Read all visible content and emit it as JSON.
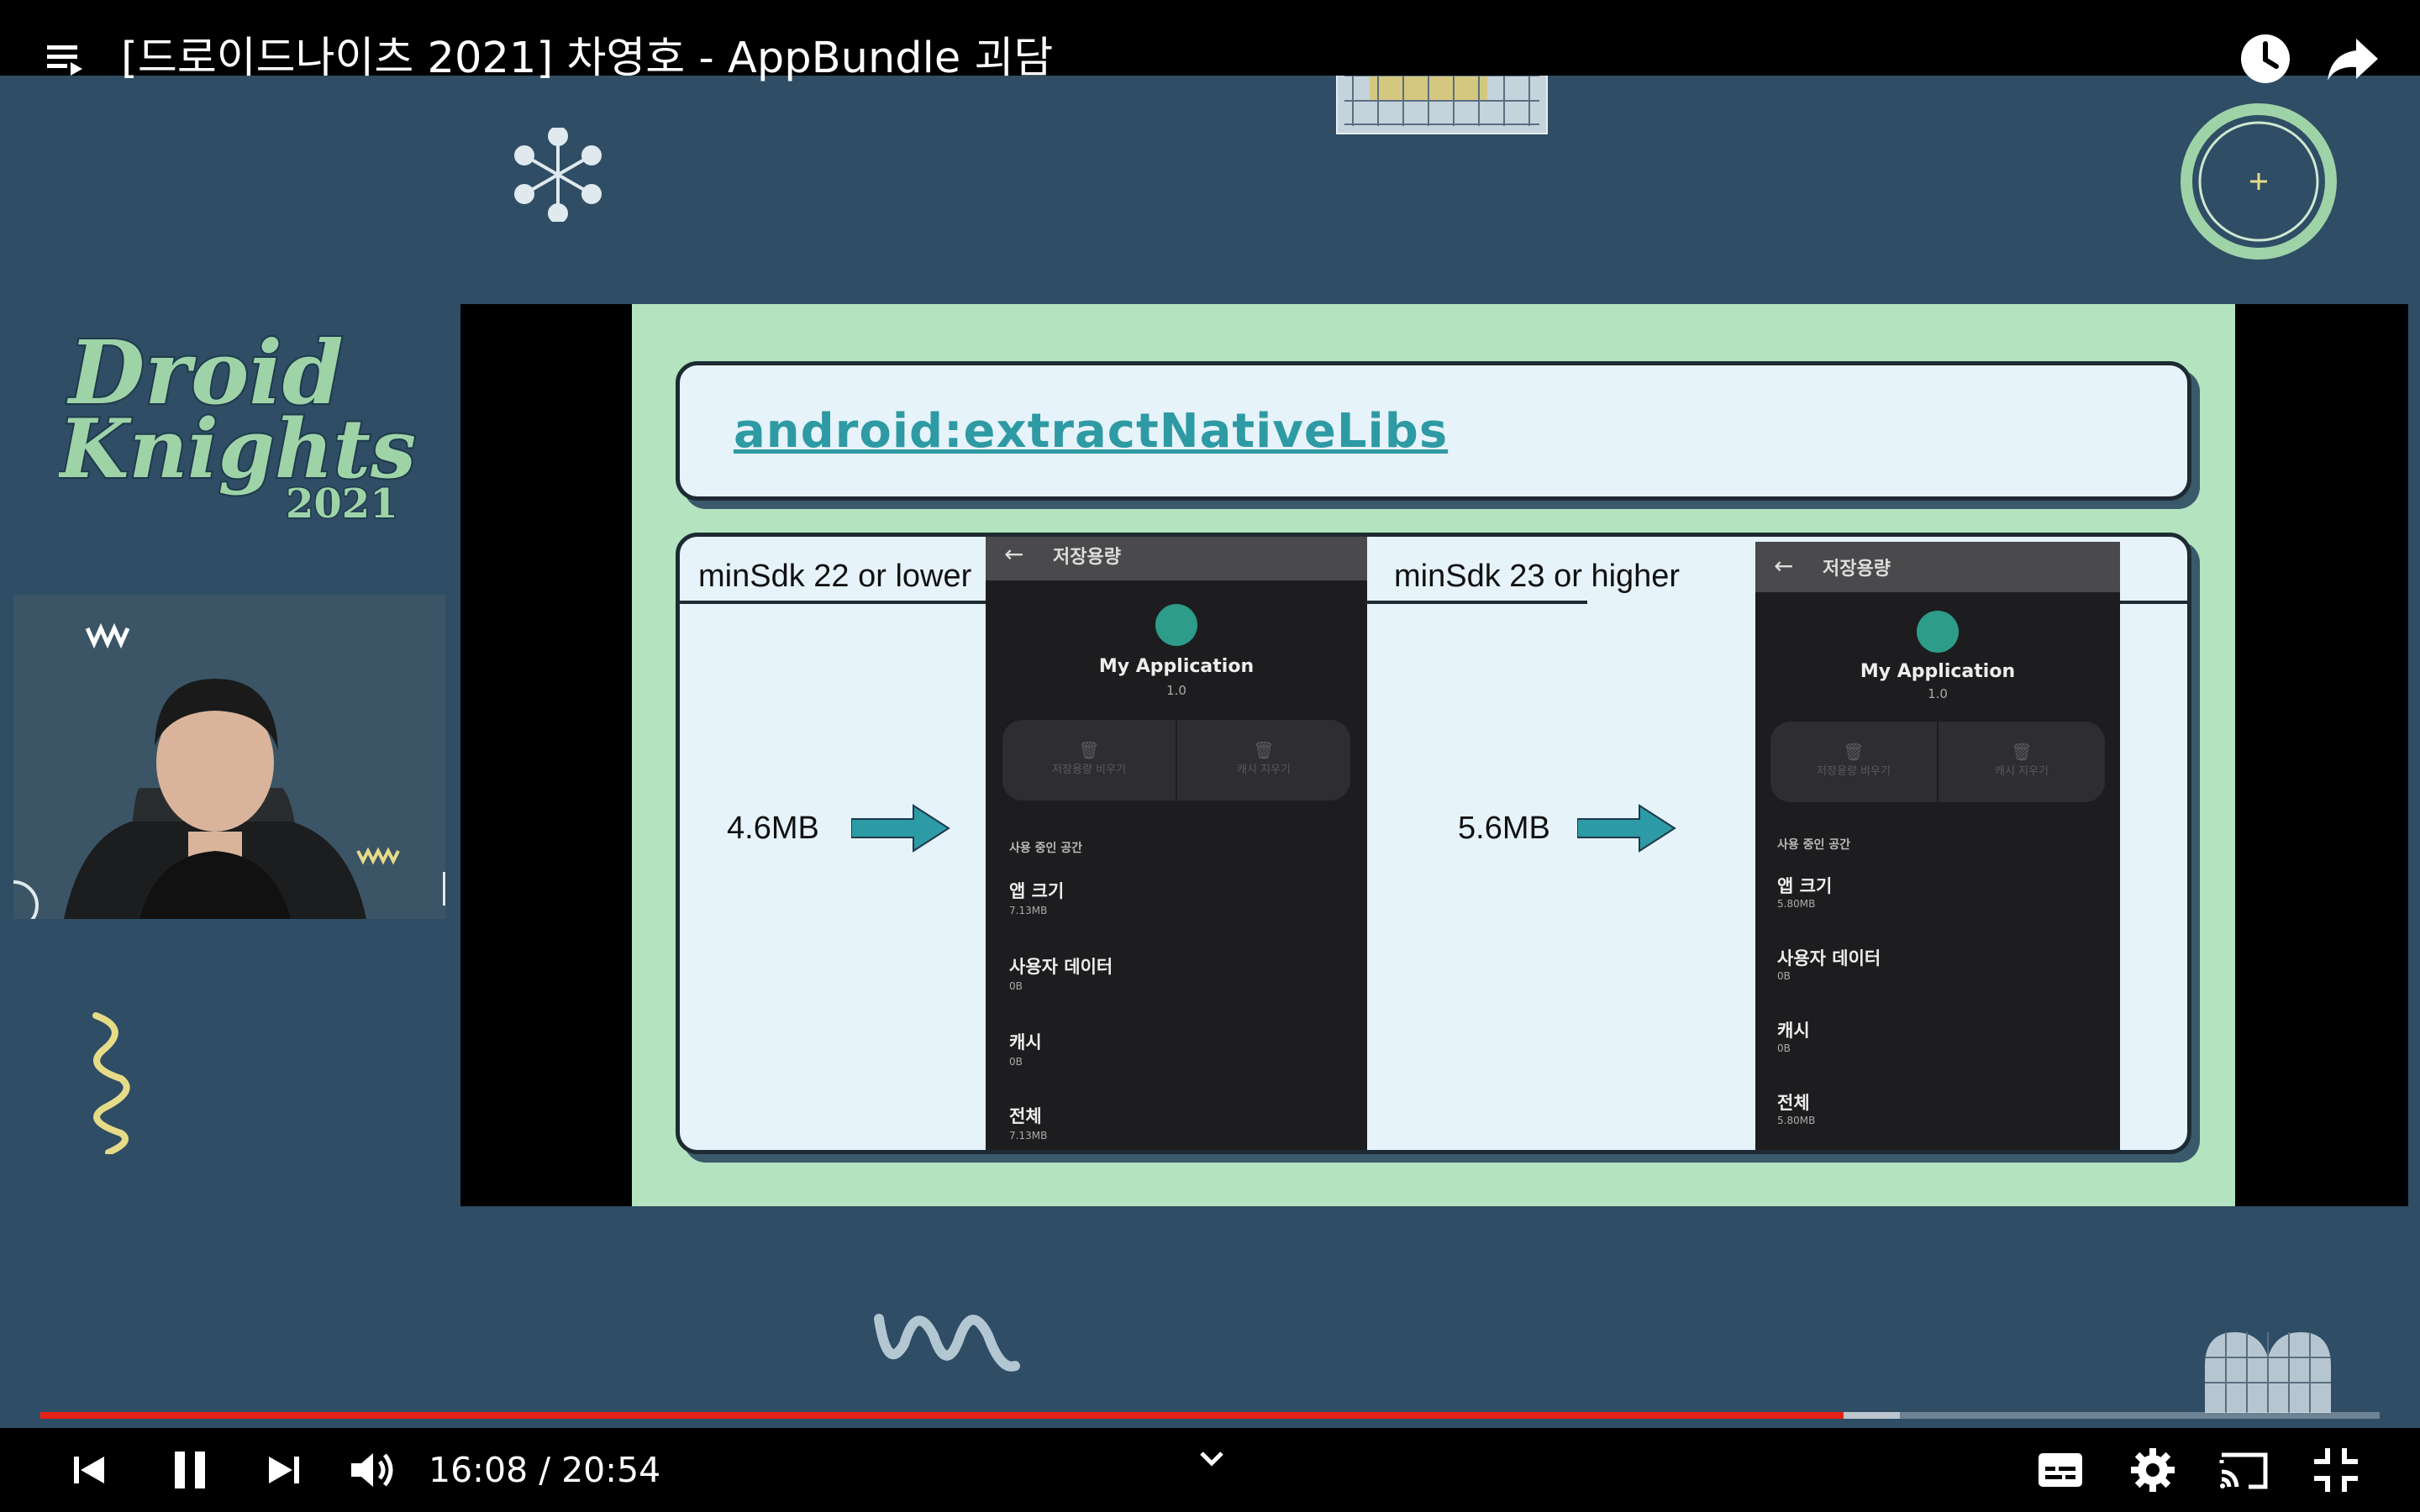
{
  "video": {
    "title": "[드로이드나이츠 2021] 차영호 - AppBundle 괴담",
    "current_time": "16:08",
    "separator": "/",
    "duration": "20:54",
    "progress_fraction": 0.771,
    "buffered_fraction": 0.795
  },
  "event": {
    "logo_line1": "Droid",
    "logo_line2": "Knights",
    "logo_year": "2021"
  },
  "slide": {
    "title": "android:extractNativeLibs",
    "left": {
      "label": "minSdk 22 or lower",
      "size": "4.6MB",
      "phone": {
        "header": "저장용량",
        "app_name": "My Application",
        "version": "1.0",
        "btn_storage": "저장용량 비우기",
        "btn_cache": "캐시 지우기",
        "section": "사용 중인 공간",
        "items": [
          {
            "label": "앱 크기",
            "value": "7.13MB"
          },
          {
            "label": "사용자 데이터",
            "value": "0B"
          },
          {
            "label": "캐시",
            "value": "0B"
          },
          {
            "label": "전체",
            "value": "7.13MB"
          }
        ]
      }
    },
    "right": {
      "label": "minSdk 23 or higher",
      "size": "5.6MB",
      "phone": {
        "header": "저장용량",
        "app_name": "My Application",
        "version": "1.0",
        "btn_storage": "저장용량 비우기",
        "btn_cache": "캐시 지우기",
        "section": "사용 중인 공간",
        "items": [
          {
            "label": "앱 크기",
            "value": "5.80MB"
          },
          {
            "label": "사용자 데이터",
            "value": "0B"
          },
          {
            "label": "캐시",
            "value": "0B"
          },
          {
            "label": "전체",
            "value": "5.80MB"
          }
        ]
      }
    }
  },
  "colors": {
    "background": "#2f4d64",
    "slide_green": "#b4e3bf",
    "accent_teal": "#2e9aa3",
    "progress_red": "#e62117",
    "logo_green": "#9ed3a8"
  },
  "icons": {
    "top_left": "playlist-icon",
    "top_right": [
      "watch-later-icon",
      "share-icon"
    ],
    "controls_left": [
      "previous-icon",
      "pause-icon",
      "next-icon",
      "volume-icon"
    ],
    "controls_center": "chevron-down-icon",
    "controls_right": [
      "subtitles-icon",
      "settings-icon",
      "cast-icon",
      "exit-fullscreen-icon"
    ]
  }
}
